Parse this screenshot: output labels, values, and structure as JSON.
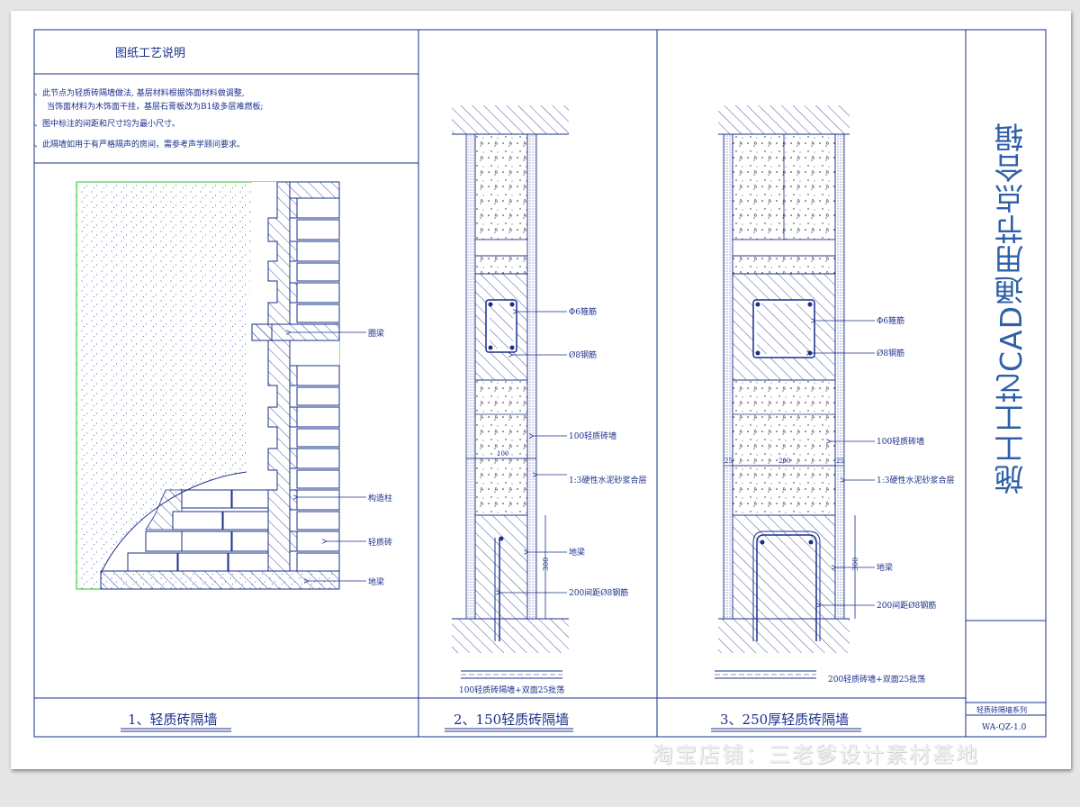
{
  "notes": {
    "title": "图纸工艺说明",
    "items": [
      "、此节点为轻质砖隔墙做法, 基层材料根据饰面材料做调整,",
      "当饰面材料为木饰面干挂，基层石膏板改为B1级多层难燃板;",
      "、图中标注的间距和尺寸均为最小尺寸。",
      "、此隔墙如用于有严格隔声的房间，需参考声学顾问要求。"
    ]
  },
  "panel1": {
    "labels": {
      "ring_beam": "圈梁",
      "column": "构造柱",
      "brick": "轻质砖",
      "ground_beam": "地梁"
    },
    "caption": "1、轻质砖隔墙"
  },
  "panel2": {
    "labels": {
      "stirrup": "Φ6箍筋",
      "rebar": "Ø8钢筋",
      "wall": "100轻质砖墙",
      "mortar": "1:3硬性水泥砂浆合层",
      "ground_beam": "地梁",
      "bar_spacing": "200间距Ø8钢筋"
    },
    "dim_width": "100",
    "dim_height": "300",
    "legend": "100轻质砖隔墙+双面25批荡",
    "caption": "2、150轻质砖隔墙"
  },
  "panel3": {
    "labels": {
      "stirrup": "Φ6箍筋",
      "rebar": "Ø8钢筋",
      "wall": "100轻质砖墙",
      "mortar": "1:3硬性水泥砂浆合层",
      "ground_beam": "地梁",
      "bar_spacing": "200间距Ø8钢筋"
    },
    "dim_width": "200",
    "dim_side_a": "25",
    "dim_side_b": "25",
    "dim_height": "300",
    "legend": "200轻质砖墙+双面25批荡",
    "caption": "3、250厚轻质砖隔墙"
  },
  "title_block": {
    "side_title": "施工工艺CAD通用节点合辑",
    "series": "轻质砖隔墙系列",
    "code": "WA-QZ-1.0"
  },
  "watermark": "淘宝店铺：三老爹设计素材基地",
  "colors": {
    "line": "#1a2f8a",
    "frame_green": "#22cc22",
    "title_blue": "#2f5fa8"
  }
}
